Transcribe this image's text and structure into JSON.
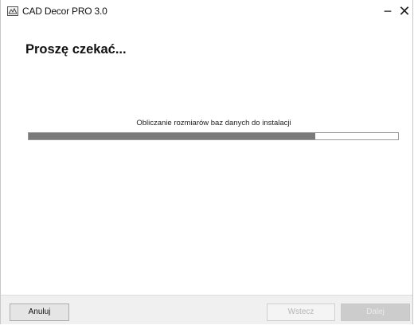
{
  "window": {
    "title": "CAD Decor PRO 3.0",
    "minimize_glyph": "−",
    "close_glyph": "✕",
    "icon": "app-logo-icon"
  },
  "main": {
    "heading": "Proszę czekać...",
    "status_text": "Obliczanie rozmiarów baz danych do instalacji",
    "progress_fraction": 0.775
  },
  "footer": {
    "cancel_label": "Anuluj",
    "back_label": "Wstecz",
    "next_label": "Dalej"
  },
  "colors": {
    "progress_fill": "#7a7a7a",
    "footer_bg": "#f0f0f0"
  }
}
